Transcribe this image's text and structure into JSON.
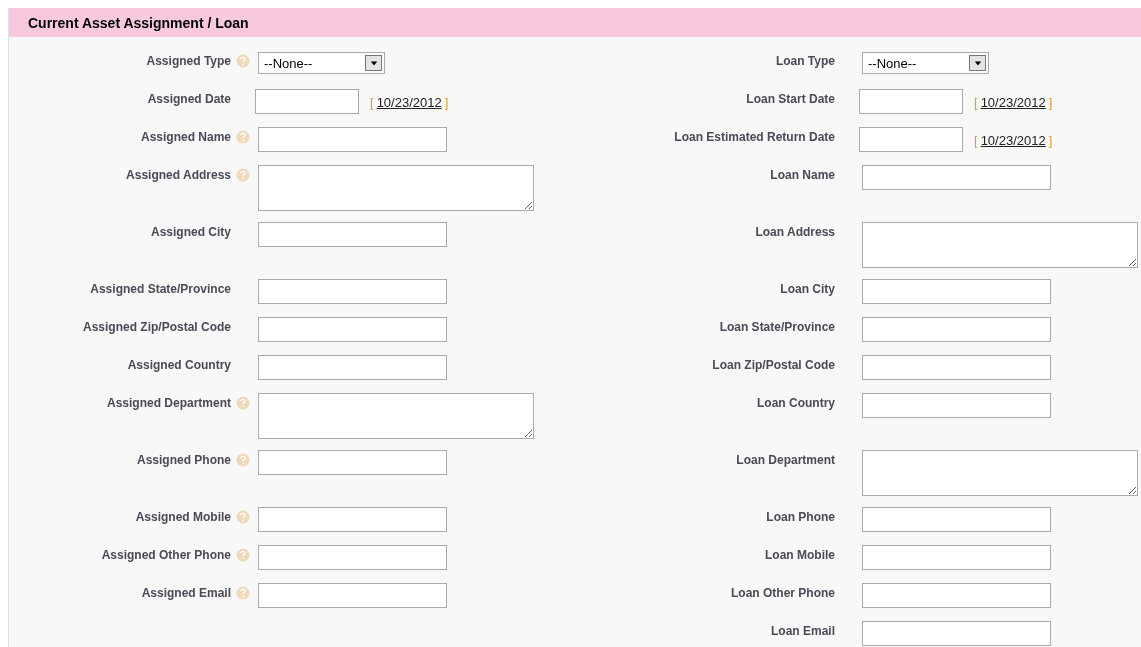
{
  "section": {
    "title": "Current Asset Assignment / Loan"
  },
  "left_fields": [
    {
      "label": "Assigned Type",
      "help": true,
      "kind": "select",
      "value": "--None--"
    },
    {
      "label": "Assigned Date",
      "help": false,
      "kind": "date",
      "today": "10/23/2012"
    },
    {
      "label": "Assigned Name",
      "help": true,
      "kind": "text"
    },
    {
      "label": "Assigned Address",
      "help": true,
      "kind": "textarea"
    },
    {
      "label": "Assigned City",
      "help": false,
      "kind": "text"
    },
    {
      "label": "Assigned State/Province",
      "help": false,
      "kind": "text"
    },
    {
      "label": "Assigned Zip/Postal Code",
      "help": false,
      "kind": "text"
    },
    {
      "label": "Assigned Country",
      "help": false,
      "kind": "text"
    },
    {
      "label": "Assigned Department",
      "help": true,
      "kind": "textarea"
    },
    {
      "label": "Assigned Phone",
      "help": true,
      "kind": "text"
    },
    {
      "label": "Assigned Mobile",
      "help": true,
      "kind": "text"
    },
    {
      "label": "Assigned Other Phone",
      "help": true,
      "kind": "text"
    },
    {
      "label": "Assigned Email",
      "help": true,
      "kind": "text"
    }
  ],
  "right_fields": [
    {
      "label": "Loan Type",
      "help": false,
      "kind": "select",
      "value": "--None--"
    },
    {
      "label": "Loan Start Date",
      "help": false,
      "kind": "date",
      "today": "10/23/2012"
    },
    {
      "label": "Loan Estimated Return Date",
      "help": false,
      "kind": "date",
      "today": "10/23/2012"
    },
    {
      "label": "Loan Name",
      "help": false,
      "kind": "text"
    },
    {
      "label": "Loan Address",
      "help": false,
      "kind": "textarea"
    },
    {
      "label": "Loan City",
      "help": false,
      "kind": "text"
    },
    {
      "label": "Loan State/Province",
      "help": false,
      "kind": "text"
    },
    {
      "label": "Loan Zip/Postal Code",
      "help": false,
      "kind": "text"
    },
    {
      "label": "Loan Country",
      "help": false,
      "kind": "text"
    },
    {
      "label": "Loan Department",
      "help": false,
      "kind": "textarea"
    },
    {
      "label": "Loan Phone",
      "help": false,
      "kind": "text"
    },
    {
      "label": "Loan Mobile",
      "help": false,
      "kind": "text"
    },
    {
      "label": "Loan Other Phone",
      "help": false,
      "kind": "text"
    },
    {
      "label": "Loan Email",
      "help": false,
      "kind": "text"
    }
  ],
  "date_brackets": {
    "open": "[",
    "close": "]"
  }
}
